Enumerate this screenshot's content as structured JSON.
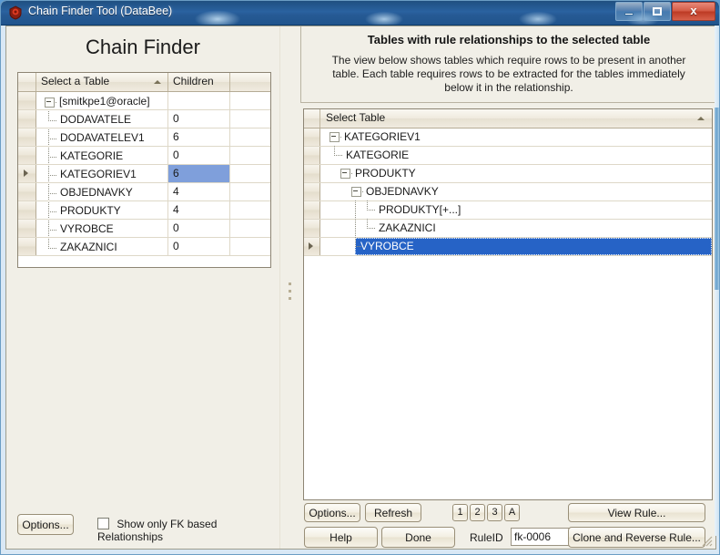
{
  "window": {
    "title": "Chain Finder Tool (DataBee)",
    "icon": "app-shield-icon",
    "minimize_label": "",
    "maximize_label": "",
    "close_label": "x"
  },
  "left": {
    "heading": "Chain Finder",
    "grid": {
      "columns": [
        "Select a Table",
        "Children",
        ""
      ],
      "sort_column": "Select a Table",
      "sort_direction": "ascending",
      "root": "[smitkpe1@oracle]",
      "rows": [
        {
          "name": "[smitkpe1@oracle]",
          "children": "",
          "level": 0,
          "expanded": true,
          "selected": false,
          "current": false
        },
        {
          "name": "DODAVATELE",
          "children": "0",
          "level": 1,
          "selected": false,
          "current": false
        },
        {
          "name": "DODAVATELEV1",
          "children": "6",
          "level": 1,
          "selected": false,
          "current": false
        },
        {
          "name": "KATEGORIE",
          "children": "0",
          "level": 1,
          "selected": false,
          "current": false
        },
        {
          "name": "KATEGORIEV1",
          "children": "6",
          "level": 1,
          "selected": true,
          "current": true
        },
        {
          "name": "OBJEDNAVKY",
          "children": "4",
          "level": 1,
          "selected": false,
          "current": false
        },
        {
          "name": "PRODUKTY",
          "children": "4",
          "level": 1,
          "selected": false,
          "current": false
        },
        {
          "name": "VYROBCE",
          "children": "0",
          "level": 1,
          "selected": false,
          "current": false
        },
        {
          "name": "ZAKAZNICI",
          "children": "0",
          "level": 1,
          "selected": false,
          "current": false
        }
      ]
    },
    "options_button": "Options...",
    "checkbox": {
      "label": "Show only FK based Relationships",
      "checked": false
    }
  },
  "right": {
    "title": "Tables with rule relationships to the selected table",
    "description": "The view below shows tables which require rows to be present in another table. Each table requires rows to be extracted for the tables immediately below it in the relationship.",
    "tree": {
      "column_header": "Select Table",
      "sort_direction": "ascending",
      "rows": [
        {
          "name": "KATEGORIEV1",
          "level": 0,
          "expanded": true,
          "selected": false,
          "current": false
        },
        {
          "name": "KATEGORIE",
          "level": 1,
          "expanded": null,
          "selected": false,
          "current": false
        },
        {
          "name": "PRODUKTY",
          "level": 1,
          "expanded": true,
          "selected": false,
          "current": false
        },
        {
          "name": "OBJEDNAVKY",
          "level": 2,
          "expanded": true,
          "selected": false,
          "current": false
        },
        {
          "name": "PRODUKTY[+...]",
          "level": 3,
          "expanded": null,
          "selected": false,
          "current": false
        },
        {
          "name": "ZAKAZNICI",
          "level": 3,
          "expanded": null,
          "selected": false,
          "current": false
        },
        {
          "name": "VYROBCE",
          "level": 2,
          "expanded": null,
          "selected": true,
          "current": true
        }
      ]
    },
    "buttons": {
      "options": "Options...",
      "refresh": "Refresh",
      "help": "Help",
      "done": "Done",
      "view_rule": "View Rule...",
      "clone_reverse_rule": "Clone and Reverse Rule...",
      "level_buttons": [
        "1",
        "2",
        "3",
        "A"
      ]
    },
    "ruleid": {
      "label": "RuleID",
      "value": "fk-0006"
    }
  },
  "colors": {
    "selection_grid": "#7f9fdb",
    "selection_tree": "#2663c6",
    "panel_bg": "#f1efe7",
    "titlebar": "#2a62a0"
  }
}
